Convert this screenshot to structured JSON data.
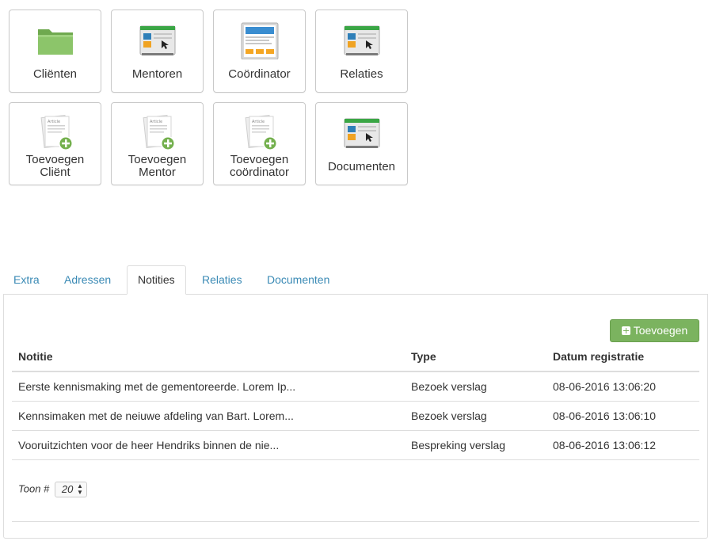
{
  "tiles": [
    {
      "label_lines": [
        "Cliënten"
      ],
      "icon": "folder-icon"
    },
    {
      "label_lines": [
        "Mentoren"
      ],
      "icon": "browser-window-icon"
    },
    {
      "label_lines": [
        "Coördinator"
      ],
      "icon": "webpage-layout-icon"
    },
    {
      "label_lines": [
        "Relaties"
      ],
      "icon": "browser-window-icon"
    },
    {
      "label_lines": [
        "Toevoegen",
        "Cliënt"
      ],
      "icon": "add-article-icon"
    },
    {
      "label_lines": [
        "Toevoegen",
        "Mentor"
      ],
      "icon": "add-article-icon"
    },
    {
      "label_lines": [
        "Toevoegen",
        "coördinator"
      ],
      "icon": "add-article-icon"
    },
    {
      "label_lines": [
        "Documenten"
      ],
      "icon": "browser-window-icon"
    }
  ],
  "article_icon_text": "Article",
  "tabs": [
    {
      "label": "Extra",
      "active": false
    },
    {
      "label": "Adressen",
      "active": false
    },
    {
      "label": "Notities",
      "active": true
    },
    {
      "label": "Relaties",
      "active": false
    },
    {
      "label": "Documenten",
      "active": false
    }
  ],
  "toolbar": {
    "add_label": "Toevoegen"
  },
  "table": {
    "headers": {
      "note": "Notitie",
      "type": "Type",
      "date": "Datum registratie"
    },
    "rows": [
      {
        "note": "Eerste kennismaking met de gementoreerde. Lorem Ip...",
        "type": "Bezoek verslag",
        "date": "08-06-2016 13:06:20"
      },
      {
        "note": "Kennsimaken met de neiuwe afdeling van Bart. Lorem...",
        "type": "Bezoek verslag",
        "date": "08-06-2016 13:06:10"
      },
      {
        "note": "Vooruitzichten voor de heer Hendriks binnen de nie...",
        "type": "Bespreking verslag",
        "date": "08-06-2016 13:06:12"
      }
    ]
  },
  "pager": {
    "label": "Toon #",
    "value": "20"
  },
  "colors": {
    "accent_green": "#7bb35f",
    "link_blue": "#3a8ab5",
    "border": "#dddddd"
  }
}
